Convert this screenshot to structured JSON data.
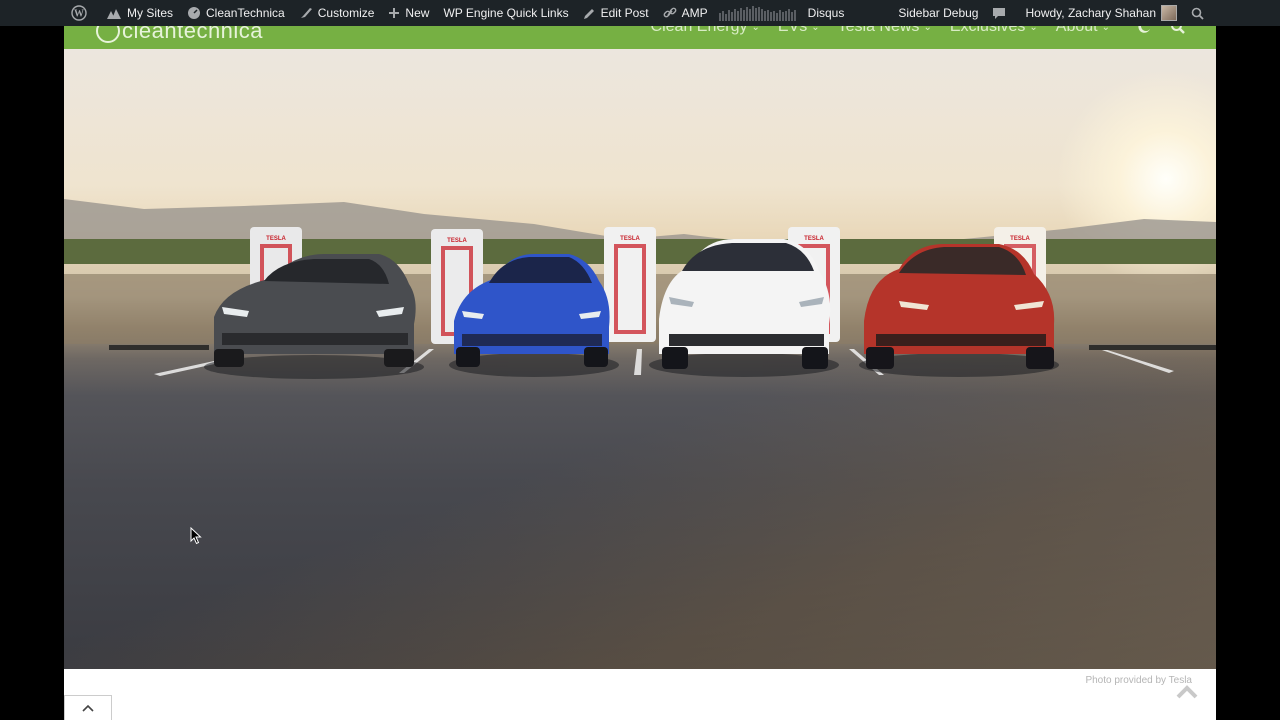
{
  "adminbar": {
    "items": [
      {
        "label": "My Sites",
        "icon": "my-sites-icon"
      },
      {
        "label": "CleanTechnica",
        "icon": "dashboard-icon"
      },
      {
        "label": "Customize",
        "icon": "brush-icon"
      },
      {
        "label": "New",
        "icon": "plus-icon"
      },
      {
        "label": "WP Engine Quick Links",
        "icon": ""
      },
      {
        "label": "Edit Post",
        "icon": "pencil-icon"
      },
      {
        "label": "AMP",
        "icon": "link-icon"
      },
      {
        "label": "Disqus",
        "icon": ""
      }
    ],
    "right": {
      "sidebar_debug": "Sidebar Debug",
      "greeting": "Howdy, Zachary Shahan"
    },
    "bg_color": "#1d2327"
  },
  "header": {
    "logo_text": "cleantechnica",
    "nav": [
      "Clean Energy",
      "EVs",
      "Tesla News",
      "Exclusives",
      "About"
    ],
    "accent_color": "#76b043"
  },
  "hero": {
    "credit": "Photo provided by Tesla",
    "charger_label": "TESLA"
  }
}
